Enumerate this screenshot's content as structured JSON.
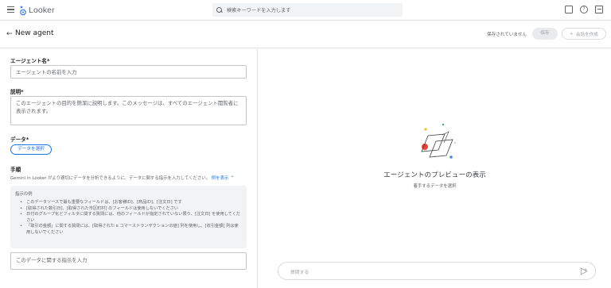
{
  "app": {
    "name": "Looker"
  },
  "search": {
    "placeholder": "検索キーワードを入力します"
  },
  "header": {
    "title": "New agent",
    "unsaved_status": "保存されていません",
    "save_label": "保存",
    "create_label": "会話を作成"
  },
  "form": {
    "name_label": "エージェント名*",
    "name_placeholder": "エージェントの名前を入力",
    "description_label": "説明*",
    "description_placeholder": "このエージェントの目的を簡潔に説明します。このメッセージは、すべてのエージェント閲覧者に表示されます。",
    "data_label": "データ*",
    "data_button": "データを選択",
    "instructions_label": "手順",
    "instructions_help": "Gemini in Looker がより適切にデータを分析できるように、データに関する指示を入力してください。",
    "examples_link": "例を表示",
    "examples_title": "指示の例",
    "examples": [
      "このデータソースで最も重要なフィールドは、[お客様ID]、[商品ID]、[注文日] です",
      "[取得された数引日]、[取得された市区町村] のフィールドは使用しないでください",
      "日付のグループ化とフィルタに関する質問には、他のフィールドが指定されていない限り、[注文日] を使用してください",
      "「取引の金額」に関する質問には、[取得された e コマーストランザクションの値] 列を使用し、[収引金額] 列は使用しないでください"
    ],
    "instructions_placeholder": "このデータに関する指示を入力"
  },
  "preview": {
    "title": "エージェントのプレビューの表示",
    "subtitle": "着手するデータを選択",
    "ask_placeholder": "質問する"
  },
  "colors": {
    "accent": "#1a73e8",
    "red": "#ea4335",
    "yellow": "#fbbc04",
    "green": "#34a853"
  }
}
